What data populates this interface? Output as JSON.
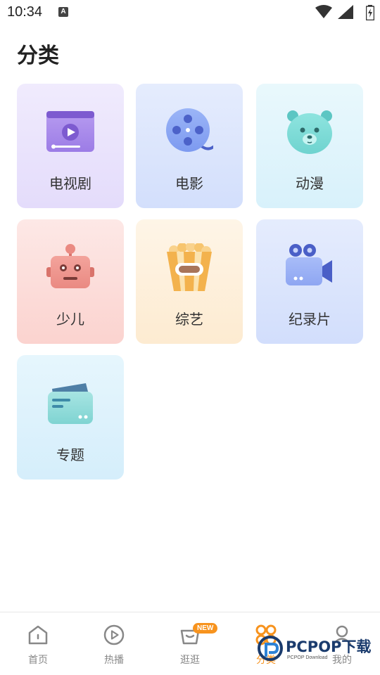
{
  "status_bar": {
    "time": "10:34",
    "notification_icon": "A"
  },
  "page": {
    "title": "分类"
  },
  "categories": [
    {
      "label": "电视剧",
      "icon": "tv-series-icon"
    },
    {
      "label": "电影",
      "icon": "film-reel-icon"
    },
    {
      "label": "动漫",
      "icon": "bear-face-icon"
    },
    {
      "label": "少儿",
      "icon": "robot-icon"
    },
    {
      "label": "综艺",
      "icon": "popcorn-icon"
    },
    {
      "label": "纪录片",
      "icon": "video-camera-icon"
    },
    {
      "label": "专题",
      "icon": "card-folder-icon"
    }
  ],
  "tab_bar": {
    "items": [
      {
        "label": "首页",
        "icon": "home-icon"
      },
      {
        "label": "热播",
        "icon": "play-circle-icon"
      },
      {
        "label": "逛逛",
        "icon": "shopping-bag-icon",
        "badge": "NEW"
      },
      {
        "label": "分类",
        "icon": "category-icon",
        "active": true
      },
      {
        "label": "我的",
        "icon": "user-icon"
      }
    ],
    "active_color": "#f7931e",
    "inactive_color": "#888888"
  },
  "watermark": {
    "brand": "PCPOP下载",
    "sub": "PCPOP Download"
  }
}
